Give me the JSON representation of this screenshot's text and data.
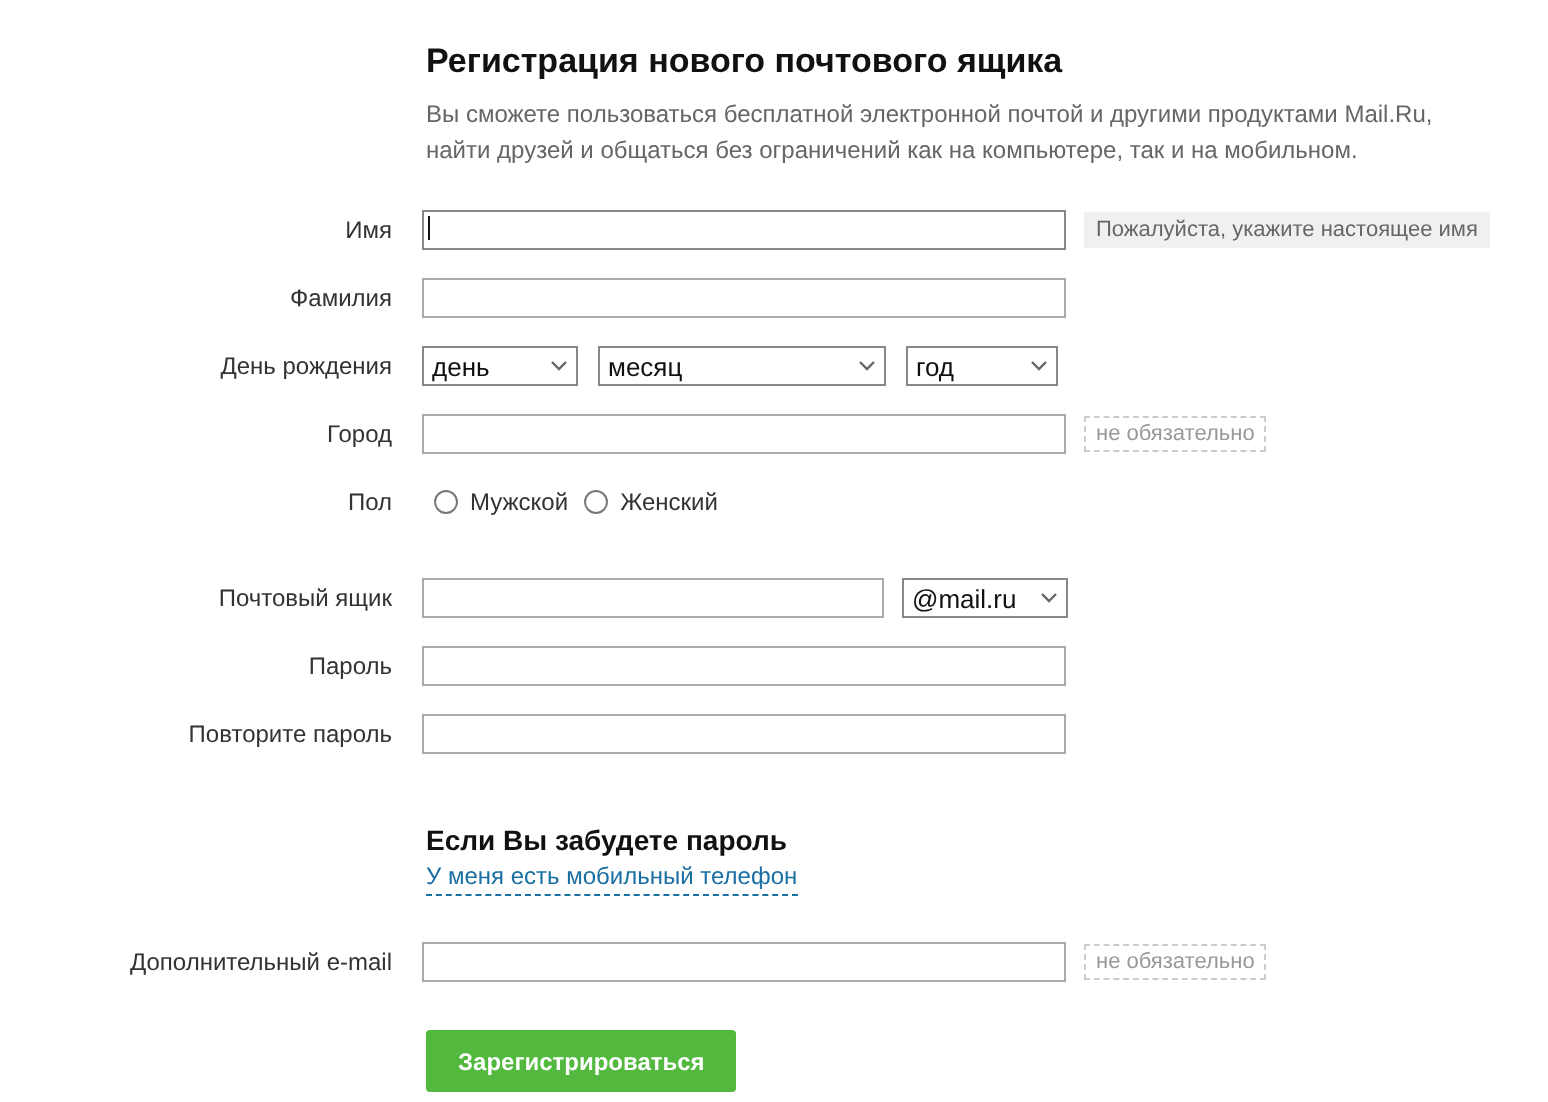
{
  "title": "Регистрация нового почтового ящика",
  "description": "Вы сможете пользоваться бесплатной электронной почтой и другими продуктами Mail.Ru, найти друзей и общаться без ограничений как на компьютере, так и на мобильном.",
  "groups": [
    [
      {
        "kind": "text",
        "label": "Имя",
        "focused": true,
        "note": {
          "kind": "hint",
          "text": "Пожалуйста, укажите настоящее имя"
        }
      },
      {
        "kind": "text",
        "label": "Фамилия",
        "focused": false
      },
      {
        "kind": "date",
        "label": "День рождения",
        "selects": [
          "день",
          "месяц",
          "год"
        ]
      },
      {
        "kind": "text",
        "label": "Город",
        "focused": false,
        "note": {
          "kind": "optional",
          "text": "не обязательно"
        }
      },
      {
        "kind": "radio",
        "label": "Пол",
        "options": [
          {
            "label": "Мужской",
            "selected": false
          },
          {
            "label": "Женский",
            "selected": false
          }
        ]
      }
    ],
    [
      {
        "kind": "email",
        "label": "Почтовый ящик",
        "domain": "@mail.ru"
      },
      {
        "kind": "text",
        "label": "Пароль",
        "focused": false
      },
      {
        "kind": "text",
        "label": "Повторите пароль",
        "focused": false
      }
    ]
  ],
  "recovery": {
    "heading": "Если Вы забудете пароль",
    "link": "У меня есть мобильный телефон"
  },
  "extra": {
    "kind": "text",
    "label": "Дополнительный e-mail",
    "focused": false,
    "note": {
      "kind": "optional",
      "text": "не обязательно"
    }
  },
  "submit": "Зарегистрироваться"
}
